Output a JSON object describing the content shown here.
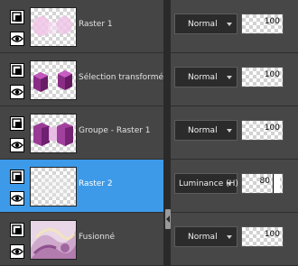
{
  "layers": [
    {
      "name": "Raster 1",
      "blend": "Normal",
      "opacity": "100",
      "thumb": "pink-blur-thumbnail",
      "selected": false
    },
    {
      "name": "Sélection transformée",
      "blend": "Normal",
      "opacity": "100",
      "thumb": "purple-cubes-thumbnail",
      "selected": false
    },
    {
      "name": "Groupe - Raster 1",
      "blend": "Normal",
      "opacity": "100",
      "thumb": "purple-cubes-thumbnail",
      "selected": false
    },
    {
      "name": "Raster 2",
      "blend": "Luminance (H)",
      "opacity": "80",
      "thumb": "transparent-thumbnail",
      "selected": true
    },
    {
      "name": "Fusionné",
      "blend": "Normal",
      "opacity": "100",
      "thumb": "merged-swirl-thumbnail",
      "selected": false
    }
  ],
  "colors": {
    "selected_row": "#3d9ae8",
    "panel_bg": "#454545",
    "control_bg": "#2b2b2b"
  },
  "icons": {
    "layer": "raster-layer-icon",
    "visibility": "eye-icon",
    "dropdown": "chevron-down-icon"
  }
}
